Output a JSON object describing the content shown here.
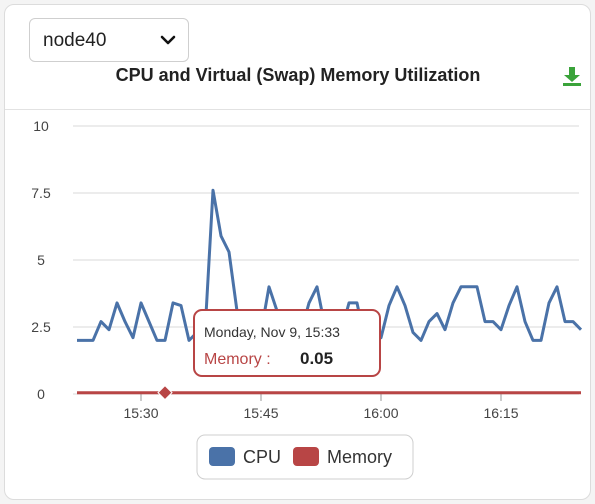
{
  "selector": {
    "value": "node40",
    "icon": "chevron-down-icon"
  },
  "download": {
    "icon": "download-icon",
    "color": "#3aa33a"
  },
  "chart_data": {
    "type": "line",
    "title": "CPU and Virtual (Swap) Memory Utilization",
    "xlabel": "",
    "ylabel": "",
    "x_start": "15:22",
    "x_interval_minutes": 1,
    "x_ticks": [
      "15:30",
      "15:45",
      "16:00",
      "16:15"
    ],
    "y_ticks": [
      "10",
      "7.5",
      "5",
      "2.5",
      "0"
    ],
    "ylim": [
      0,
      10
    ],
    "grid": "horizontal",
    "series": [
      {
        "name": "CPU",
        "color": "#4a72a8",
        "values": [
          2.0,
          2.0,
          2.0,
          2.7,
          2.4,
          3.4,
          2.7,
          2.1,
          3.4,
          2.7,
          2.0,
          2.0,
          3.4,
          3.3,
          2.0,
          2.3,
          2.3,
          7.6,
          5.9,
          5.3,
          3.1,
          2.3,
          2.3,
          2.3,
          4.0,
          3.1,
          2.3,
          2.3,
          2.3,
          3.4,
          4.0,
          2.5,
          2.3,
          2.3,
          3.4,
          3.4,
          2.0,
          2.1,
          2.1,
          3.3,
          4.0,
          3.3,
          2.3,
          2.0,
          2.7,
          3.0,
          2.4,
          3.4,
          4.0,
          4.0,
          4.0,
          2.7,
          2.7,
          2.4,
          3.3,
          4.0,
          2.7,
          2.0,
          2.0,
          3.4,
          4.0,
          2.7,
          2.7,
          2.4
        ]
      },
      {
        "name": "Memory",
        "color": "#b84545",
        "values": [
          0.05,
          0.05,
          0.05,
          0.05,
          0.05,
          0.05,
          0.05,
          0.05,
          0.05,
          0.05,
          0.05,
          0.05,
          0.05,
          0.05,
          0.05,
          0.05,
          0.05,
          0.05,
          0.05,
          0.05,
          0.05,
          0.05,
          0.05,
          0.05,
          0.05,
          0.05,
          0.05,
          0.05,
          0.05,
          0.05,
          0.05,
          0.05,
          0.05,
          0.05,
          0.05,
          0.05,
          0.05,
          0.05,
          0.05,
          0.05,
          0.05,
          0.05,
          0.05,
          0.05,
          0.05,
          0.05,
          0.05,
          0.05,
          0.05,
          0.05,
          0.05,
          0.05,
          0.05,
          0.05,
          0.05,
          0.05,
          0.05,
          0.05,
          0.05,
          0.05,
          0.05,
          0.05,
          0.05,
          0.05
        ]
      }
    ],
    "tooltip": {
      "date": "Monday, Nov 9, 15:33",
      "series": "Memory",
      "separator": ":",
      "value": "0.05",
      "index": 11
    },
    "legend": {
      "position": "bottom-center",
      "items": [
        "CPU",
        "Memory"
      ]
    }
  }
}
